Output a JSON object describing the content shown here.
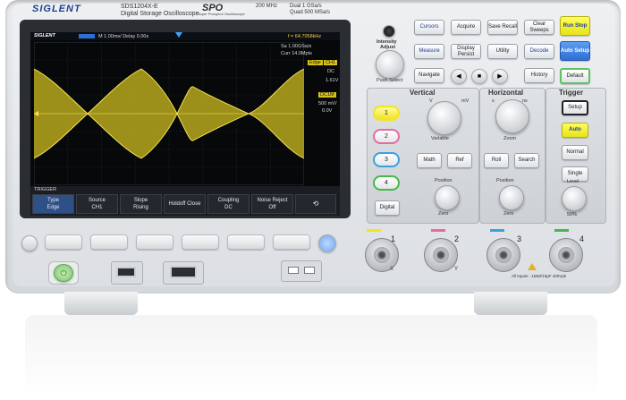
{
  "branding": {
    "logo": "SIGLENT",
    "model": "SDS1204X-E",
    "model_subtitle": "Digital Storage Oscilloscope",
    "spo": "SPO",
    "spo_subtitle": "Super Phosphor Oscilloscope",
    "bandwidth": "200 MHz",
    "spec_line1": "Dual   1 GSa/s",
    "spec_line2": "Quad  500 MSa/s"
  },
  "screen": {
    "logo": "SIGLENT",
    "timebase": "M 1.00ms/  Delay 0.00s",
    "freq": "f = 64.7058kHz",
    "sample_rate": "Sa 1.00GSa/s",
    "curr": "Curr 14.0Mpts",
    "trigger_edge": "Edge",
    "trigger_ch": "CH1",
    "trigger_coupling": "DC",
    "trigger_level": "1.61V",
    "channel_badge": "DC1M",
    "channel_scale": "500 mV/",
    "channel_offset": "0.0V",
    "menu_title": "TRIGGER",
    "menu": [
      {
        "label": "Type",
        "value": "Edge"
      },
      {
        "label": "Source",
        "value": "CH1"
      },
      {
        "label": "Slope",
        "value": "Rising"
      },
      {
        "label": "Holdoff Close",
        "value": ""
      },
      {
        "label": "Coupling",
        "value": "DC"
      },
      {
        "label": "Noise Reject",
        "value": "Off"
      }
    ]
  },
  "intensity": {
    "title": "Intensity",
    "adjust": "Adjust",
    "select": "Push Select"
  },
  "keys": {
    "cursors": "Cursors",
    "acquire": "Acquire",
    "save_recall": "Save Recall",
    "clear_sweeps": "Clear Sweeps",
    "measure": "Measure",
    "display_persist": "Display Persist",
    "utility": "Utility",
    "decode": "Decode",
    "navigate": "Navigate",
    "history": "History",
    "run_stop": "Run Stop",
    "auto_setup": "Auto Setup",
    "default": "Default"
  },
  "vertical": {
    "title": "Vertical",
    "variable": "Variable",
    "math": "Math",
    "ref": "Ref",
    "position": "Position",
    "zero": "Zero",
    "unit_v": "V",
    "unit_mv": "mV",
    "digital": "Digital",
    "channels": [
      "1",
      "2",
      "3",
      "4"
    ]
  },
  "horizontal": {
    "title": "Horizontal",
    "zoom": "Zoom",
    "roll": "Roll",
    "search": "Search",
    "position": "Position",
    "zero": "Zero",
    "unit_s": "s",
    "unit_ns": "ns"
  },
  "trigger": {
    "title": "Trigger",
    "setup": "Setup",
    "auto": "Auto",
    "normal": "Normal",
    "single": "Single",
    "level": "Level",
    "fifty": "50%"
  },
  "inputs": {
    "labels": [
      "1",
      "2",
      "3",
      "4"
    ],
    "axis_x": "X",
    "axis_y": "Y",
    "warning": "All Inputs : 1MΩ//15pF  400Vpk"
  },
  "colors": {
    "ch1": "#f4e51c",
    "ch2": "#e66aa4",
    "ch3": "#3aa0e0",
    "ch4": "#47b84a",
    "brand": "#1e3f8f"
  }
}
